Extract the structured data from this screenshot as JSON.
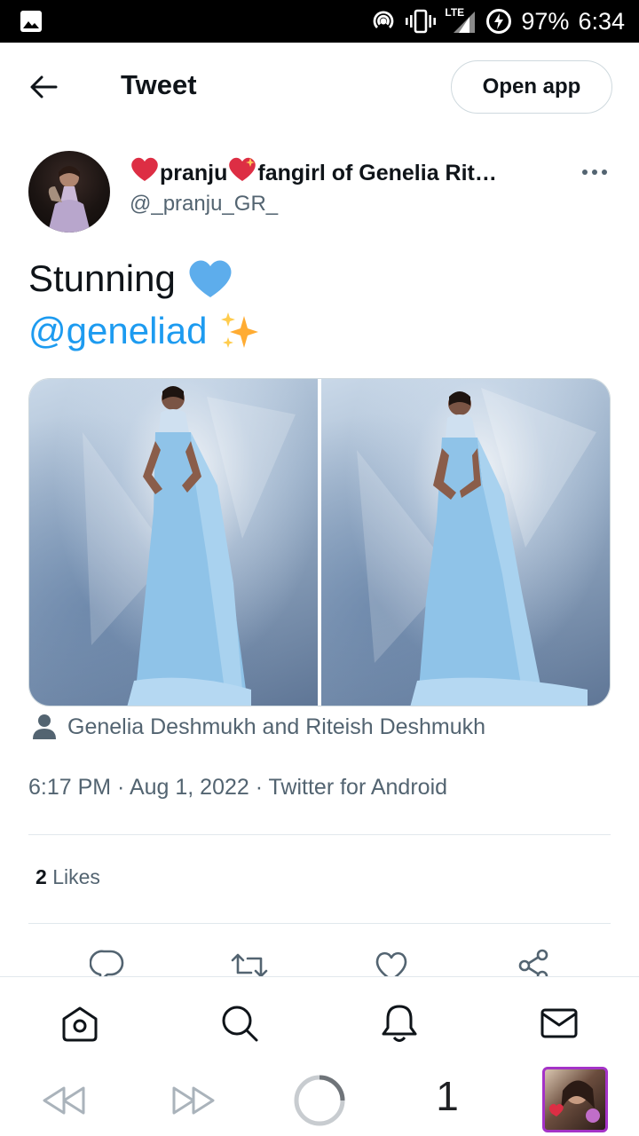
{
  "status_bar": {
    "lte": "LTE",
    "battery": "97%",
    "time": "6:34"
  },
  "header": {
    "title": "Tweet",
    "open_app": "Open app"
  },
  "tweet": {
    "display_name_part1": "pranju",
    "display_name_part2": "fangirl of Genelia Rit…",
    "handle": "@_pranju_GR_",
    "text": "Stunning",
    "mention": "@geneliad",
    "people_tag": "Genelia Deshmukh and Riteish Deshmukh",
    "timestamp": "6:17 PM · Aug 1, 2022 · Twitter for Android",
    "likes_count": "2",
    "likes_label": "Likes"
  },
  "icons": {
    "back": "arrow-left-icon",
    "more": "more-horizontal-icon",
    "reply": "reply-icon",
    "retweet": "retweet-icon",
    "like": "heart-icon",
    "share": "share-icon",
    "home": "home-icon",
    "search": "search-icon",
    "notifications": "bell-icon",
    "messages": "mail-icon"
  },
  "system_nav": {
    "tab_count": "1"
  },
  "colors": {
    "link": "#1d9bf0",
    "secondary_text": "#536471",
    "primary_text": "#0f1419",
    "border": "#cfd9de"
  }
}
